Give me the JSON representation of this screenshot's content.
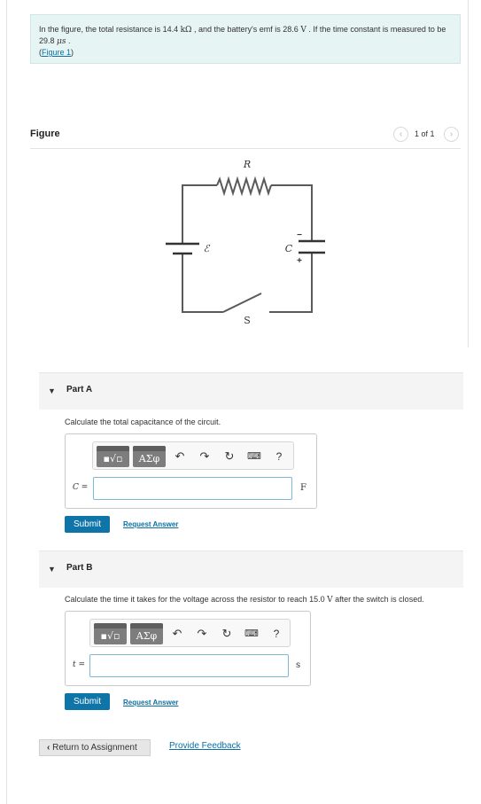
{
  "intro": {
    "t1": "In the figure, the total resistance is 14.4 ",
    "resistance_unit": "kΩ",
    "t2": " , and the battery's emf is 28.6 ",
    "emf_unit": "V",
    "t3": " . If the time constant is measured to be 29.8 ",
    "time_unit": "μs",
    "t4": " .",
    "link_open": "(",
    "figure_link": "Figure 1",
    "link_close": ")"
  },
  "figure": {
    "title": "Figure",
    "pager_text": "1 of 1",
    "prev_icon": "‹",
    "next_icon": "›",
    "labels": {
      "R": "R",
      "emf": "ℰ",
      "C": "C",
      "minus": "−",
      "plus": "+",
      "S": "S"
    }
  },
  "part_a": {
    "caret": "▼",
    "title": "Part A",
    "prompt": "Calculate the total capacitance of the circuit.",
    "variable": "C",
    "equals": " =",
    "input_value": "",
    "unit": "F",
    "submit": "Submit",
    "request": "Request Answer"
  },
  "part_b": {
    "caret": "▼",
    "title": "Part B",
    "prompt_1": "Calculate the time it takes for the voltage across the resistor to reach 15.0 ",
    "prompt_unit": "V",
    "prompt_2": " after the switch is closed.",
    "variable": "t",
    "equals": " =",
    "input_value": "",
    "unit": "s",
    "submit": "Submit",
    "request": "Request Answer"
  },
  "toolbar": {
    "template_label": "▪√▫",
    "greek_label": "ΑΣφ",
    "undo_icon": "↶",
    "redo_icon": "↷",
    "reset_icon": "↻",
    "keyboard_icon": "⌨",
    "help_icon": "?"
  },
  "footer": {
    "return_label": "Return to Assignment",
    "return_icon": "‹",
    "feedback_label": "Provide Feedback"
  }
}
